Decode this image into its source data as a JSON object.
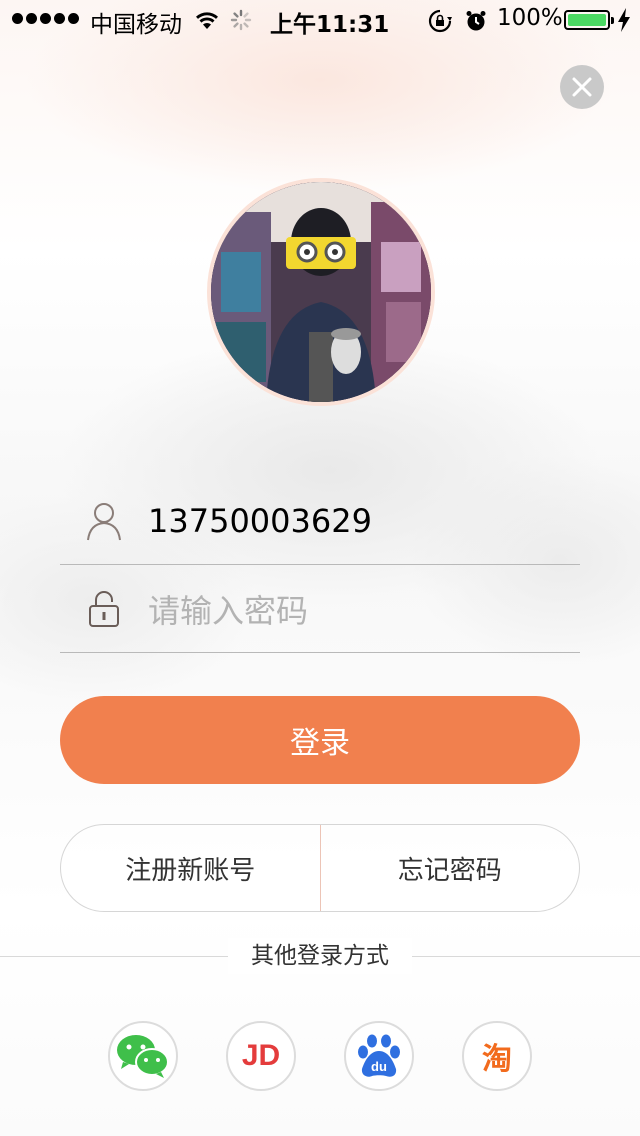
{
  "status_bar": {
    "carrier": "中国移动",
    "time": "上午11:31",
    "battery_percent": "100%",
    "battery_color": "#4cd964"
  },
  "close_icon": "close-icon",
  "avatar": {
    "icon": "user-photo"
  },
  "login_form": {
    "username_value": "13750003629",
    "password_placeholder": "请输入密码",
    "login_label": "登录",
    "accent_color": "#f1804e"
  },
  "links": {
    "register_label": "注册新账号",
    "forgot_label": "忘记密码"
  },
  "other_login": {
    "title": "其他登录方式",
    "providers": [
      {
        "name": "wechat",
        "icon": "wechat-icon"
      },
      {
        "name": "jd",
        "icon": "jd-icon",
        "text": "JD"
      },
      {
        "name": "baidu",
        "icon": "baidu-icon",
        "text": "du"
      },
      {
        "name": "taobao",
        "icon": "taobao-icon",
        "text": "淘"
      }
    ]
  }
}
